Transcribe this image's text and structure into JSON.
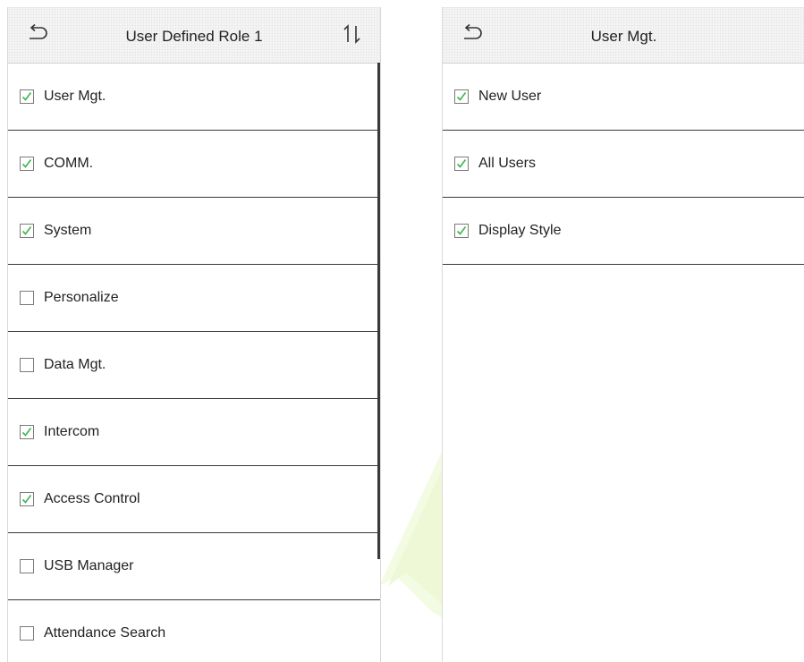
{
  "left_panel": {
    "title": "User Defined Role 1",
    "back_icon": "back-arrow-icon",
    "sort_icon": "sort-arrows-icon",
    "items": [
      {
        "label": "User Mgt.",
        "checked": true
      },
      {
        "label": "COMM.",
        "checked": true
      },
      {
        "label": "System",
        "checked": true
      },
      {
        "label": "Personalize",
        "checked": false
      },
      {
        "label": "Data Mgt.",
        "checked": false
      },
      {
        "label": "Intercom",
        "checked": true
      },
      {
        "label": "Access Control",
        "checked": true
      },
      {
        "label": "USB Manager",
        "checked": false
      },
      {
        "label": "Attendance Search",
        "checked": false
      }
    ]
  },
  "right_panel": {
    "title": "User Mgt.",
    "back_icon": "back-arrow-icon",
    "items": [
      {
        "label": "New User",
        "checked": true
      },
      {
        "label": "All Users",
        "checked": true
      },
      {
        "label": "Display Style",
        "checked": true
      }
    ]
  },
  "colors": {
    "check_green": "#3fb34f",
    "divider": "#3a3a3a",
    "titlebar_bg": "#f6f6f6"
  }
}
